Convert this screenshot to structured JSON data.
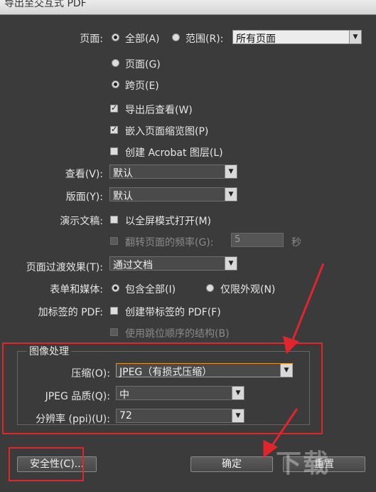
{
  "title": "导出至交互式 PDF",
  "pages": {
    "label": "页面:",
    "all_label": "全部(A)",
    "range_label": "范围(R):",
    "range_value": "所有页面",
    "single_pages_label": "页面(G)",
    "spreads_label": "跨页(E)",
    "view_after_export_label": "导出后查看(W)",
    "embed_thumbnails_label": "嵌入页面缩览图(P)",
    "create_layers_label": "创建 Acrobat 图层(L)"
  },
  "view": {
    "label": "查看(V):",
    "value": "默认"
  },
  "layout": {
    "label": "版面(Y):",
    "value": "默认"
  },
  "presentation": {
    "label": "演示文稿:",
    "fullscreen_label": "以全屏模式打开(M)",
    "flip_label": "翻转页面的频率(G):",
    "flip_value": "5",
    "flip_unit": "秒"
  },
  "transition": {
    "label": "页面过渡效果(T):",
    "value": "通过文档"
  },
  "forms_media": {
    "label": "表单和媒体:",
    "include_all_label": "包含全部(I)",
    "appearance_only_label": "仅限外观(N)"
  },
  "tagged_pdf": {
    "label": "加标签的 PDF:",
    "create_tagged_label": "创建带标签的 PDF(F)",
    "tab_order_label": "使用跳位顺序的结构(B)"
  },
  "image_handling": {
    "group_title": "图像处理",
    "compression_label": "压缩(O):",
    "compression_value": "JPEG（有损式压缩）",
    "jpeg_quality_label": "JPEG 品质(Q):",
    "jpeg_quality_value": "中",
    "resolution_label": "分辨率 (ppi)(U):",
    "resolution_value": "72"
  },
  "buttons": {
    "security_label": "安全性(C)...",
    "ok_label": "确定",
    "reset_label": "重置"
  },
  "watermark": "下载",
  "colors": {
    "background": "#3b3b3b",
    "highlight_red": "#e0262c",
    "focus_orange": "#e8922a"
  }
}
